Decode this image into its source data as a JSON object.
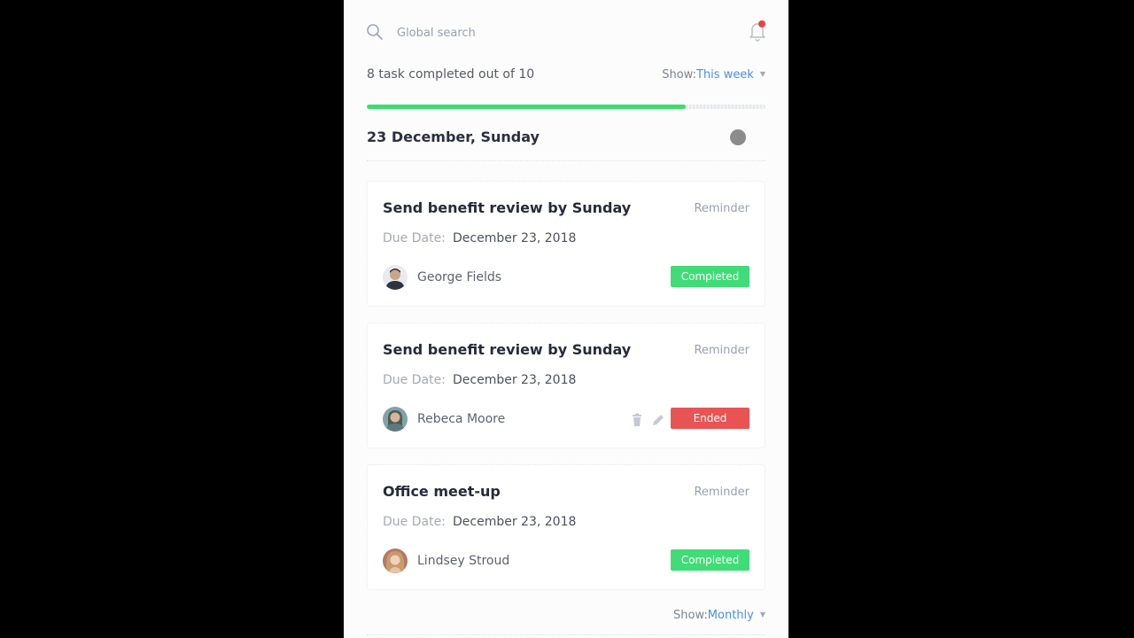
{
  "search": {
    "placeholder": "Global search",
    "icon": "search-icon"
  },
  "notifications": {
    "icon": "bell-icon",
    "has_unread": true,
    "dot_color": "#e84343"
  },
  "summary": {
    "text": "8 task completed out of 10",
    "completed": 8,
    "total": 10,
    "progress_fraction": 0.8,
    "progress_color": "#3ddc6e"
  },
  "filter": {
    "label": "Show:",
    "value": "This week"
  },
  "date_heading": "23 December, Sunday",
  "tasks": [
    {
      "title": "Send benefit review by Sunday",
      "reminder": "Reminder",
      "due_label": "Due Date:",
      "due_value": "December 23, 2018",
      "assignee": "George Fields",
      "status": "Completed",
      "status_color": "#3fdc77"
    },
    {
      "title": "Send benefit review by Sunday",
      "reminder": "Reminder",
      "due_label": "Due Date:",
      "due_value": "December 23, 2018",
      "assignee": "Rebeca Moore",
      "status": "Ended",
      "status_color": "#e85454",
      "actions": [
        "trash-icon",
        "pencil-icon"
      ]
    },
    {
      "title": "Office meet-up",
      "reminder": "Reminder",
      "due_label": "Due Date:",
      "due_value": "December 23, 2018",
      "assignee": "Lindsey Stroud",
      "status": "Completed",
      "status_color": "#3fdc77"
    }
  ],
  "footer_filter": {
    "label": "Show:",
    "value": "Monthly"
  }
}
